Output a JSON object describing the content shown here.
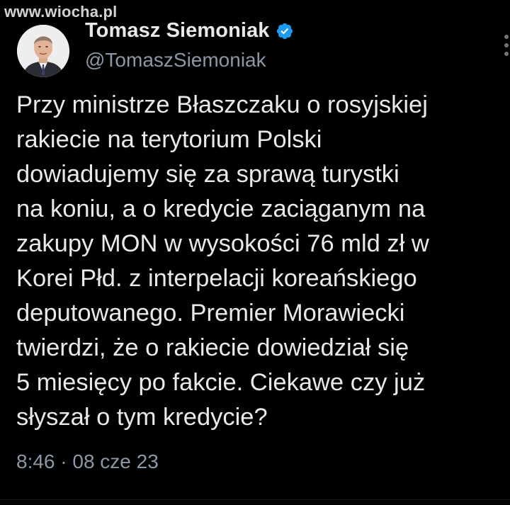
{
  "watermark": "www.wiocha.pl",
  "author": {
    "display_name": "Tomasz Siemoniak",
    "handle": "@TomaszSiemoniak",
    "verified_icon": "verified-badge-icon"
  },
  "tweet": {
    "lines": [
      "Przy ministrze Błaszczaku o rosyjskiej",
      "rakiecie na terytorium Polski",
      "dowiadujemy się za sprawą turystki",
      "na koniu, a o kredycie zaciąganym na",
      "zakupy MON w wysokości 76 mld zł w",
      "Korei Płd. z interpelacji koreańskiego",
      "deputowanego. Premier Morawiecki",
      "twierdzi, że o rakiecie dowiedział się",
      "5 miesięcy po fakcie. Ciekawe czy już",
      "słyszał o tym kredycie?"
    ],
    "timestamp": "8:46 · 08 cze 23"
  },
  "colors": {
    "background": "#000000",
    "text": "#e7e9ea",
    "secondary": "#8b98a5",
    "verified": "#1d9bf0"
  }
}
